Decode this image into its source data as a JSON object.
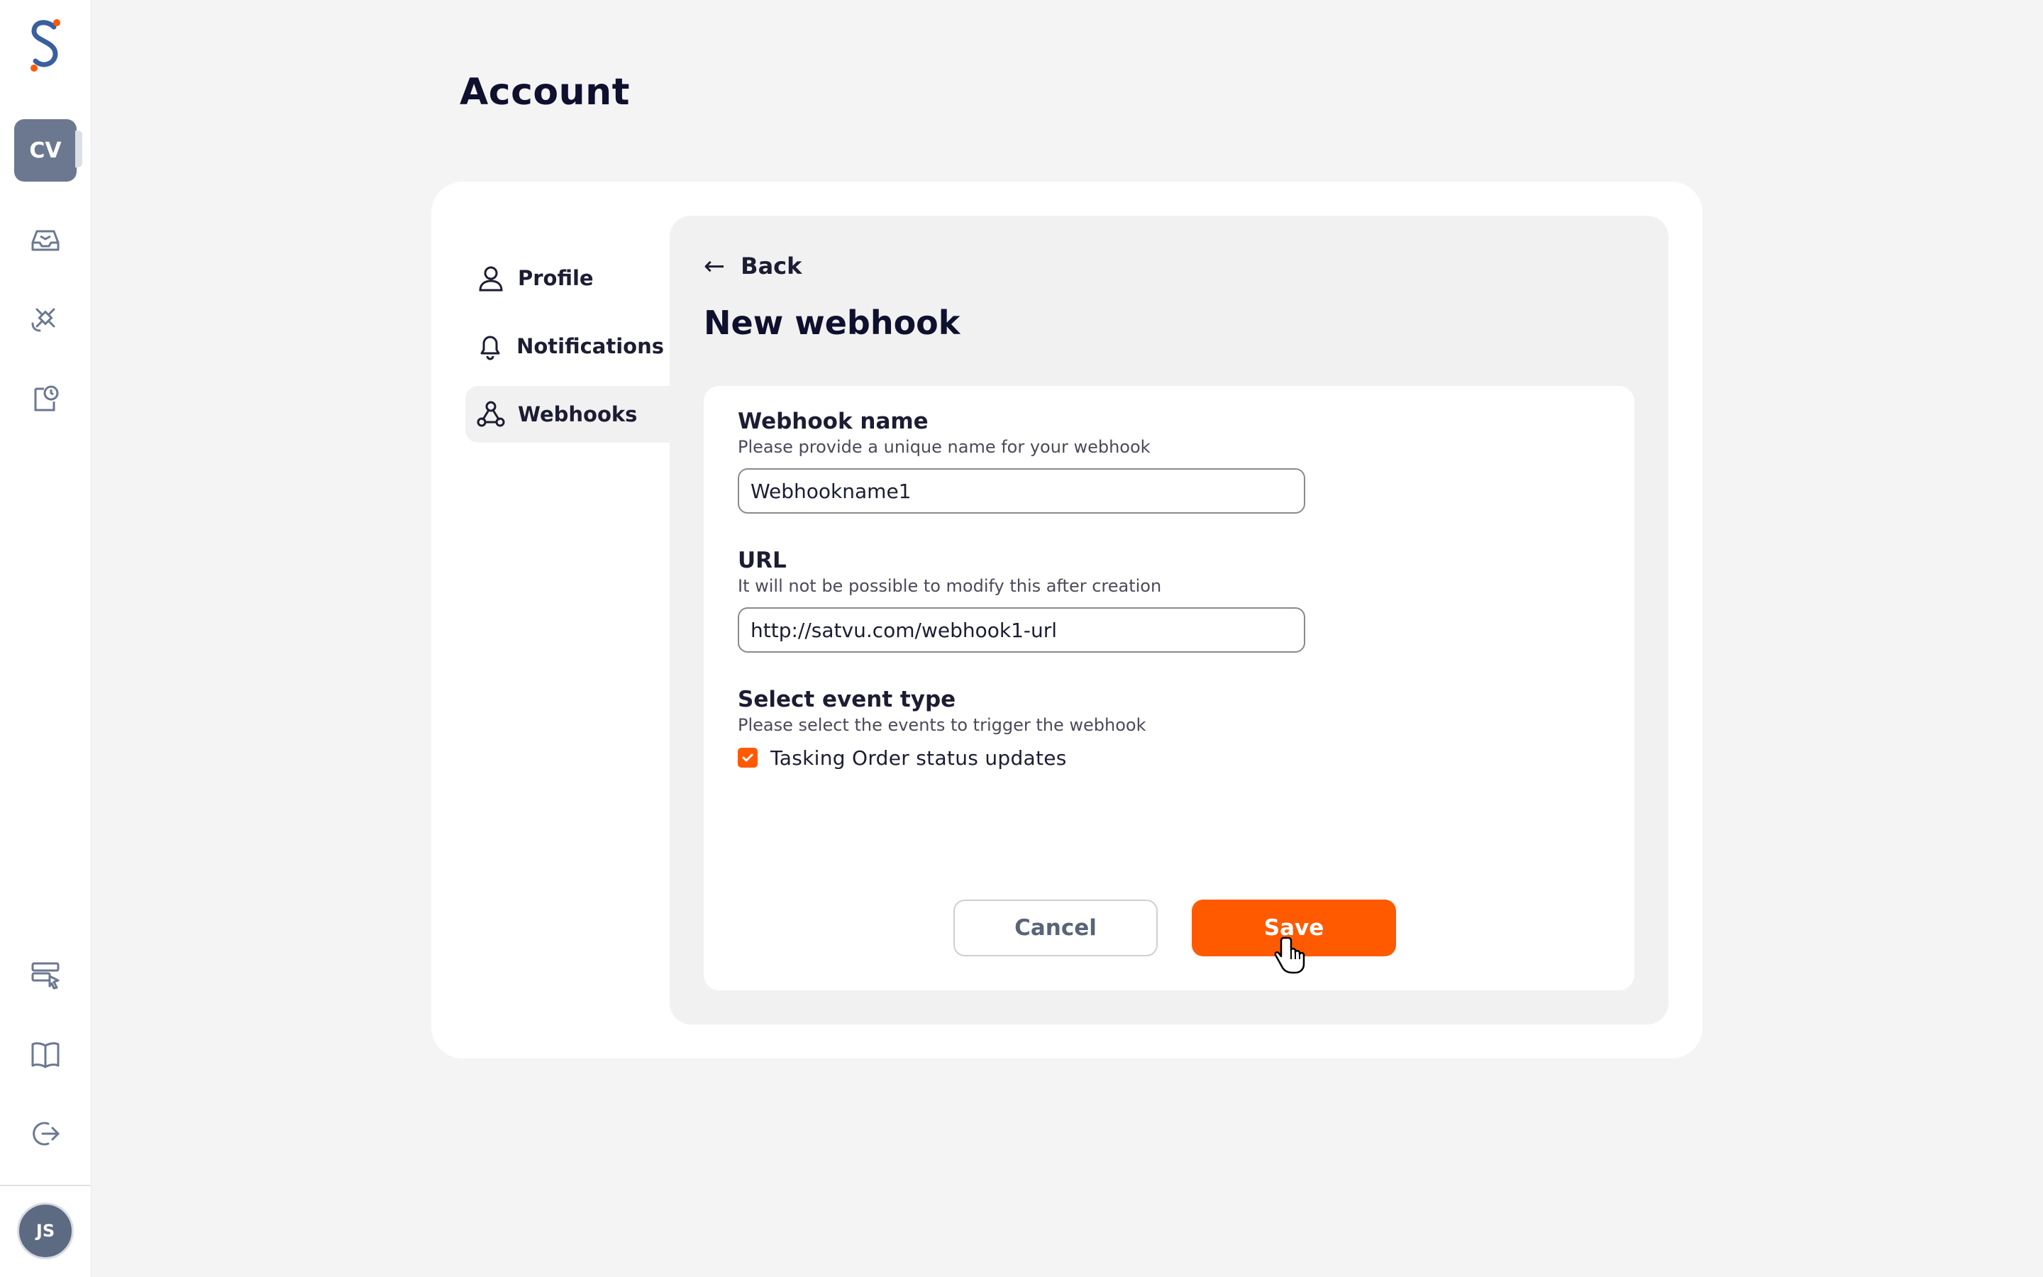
{
  "rail": {
    "org_initials": "CV",
    "icons": [
      "inbox-icon",
      "satellite-icon",
      "clipboard-clock-icon",
      "server-cursor-icon",
      "book-icon",
      "logout-icon"
    ],
    "user_initials": "JS"
  },
  "page": {
    "title": "Account"
  },
  "account_nav": [
    {
      "label": "Profile",
      "icon": "user-icon"
    },
    {
      "label": "Notifications",
      "icon": "bell-icon"
    },
    {
      "label": "Webhooks",
      "icon": "webhook-icon",
      "active": true
    }
  ],
  "panel": {
    "back_label": "Back",
    "title": "New webhook"
  },
  "form": {
    "name": {
      "label": "Webhook name",
      "help": "Please provide a unique name for your webhook",
      "value": "Webhookname1"
    },
    "url": {
      "label": "URL",
      "help": "It will not be possible to modify this after creation",
      "value": "http://satvu.com/webhook1-url"
    },
    "event_type": {
      "label": "Select event type",
      "help": "Please select the events to trigger the webhook",
      "options": [
        {
          "label": "Tasking Order status updates",
          "checked": true
        }
      ]
    },
    "cancel_label": "Cancel",
    "save_label": "Save"
  },
  "colors": {
    "accent": "#ff5a00",
    "navy": "#0f0f2e",
    "org_badge": "#6b7890"
  }
}
